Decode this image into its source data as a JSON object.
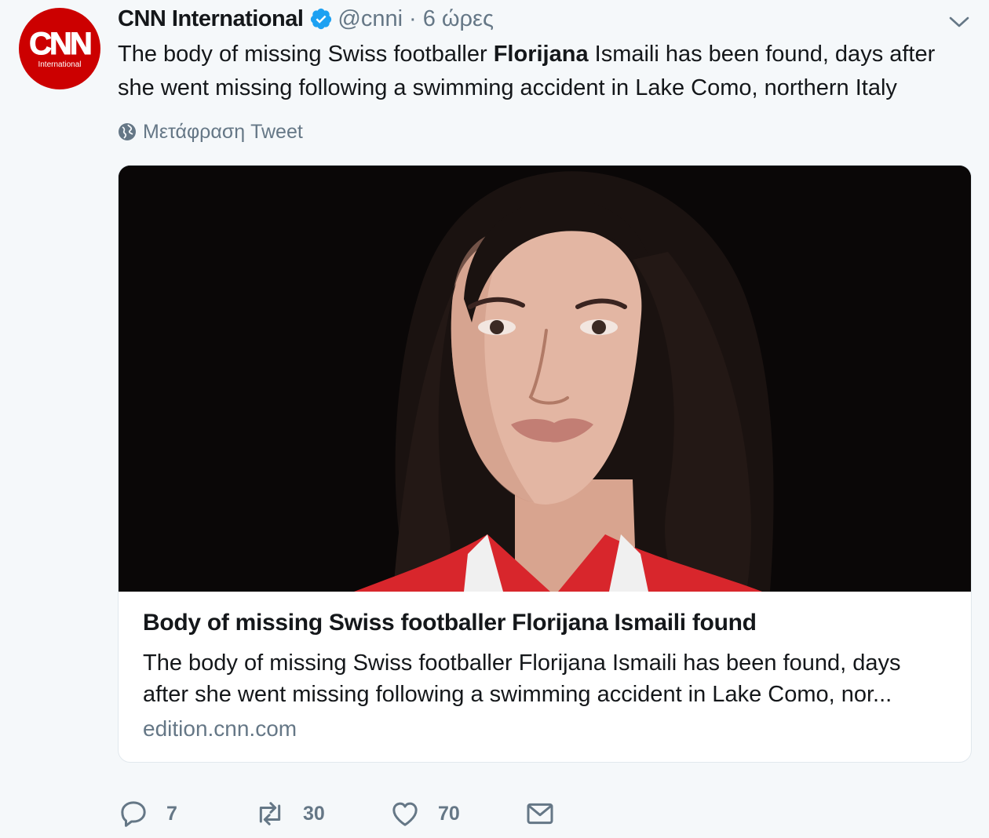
{
  "tweet": {
    "author": {
      "name": "CNN International",
      "handle": "@cnni",
      "separator": "·",
      "time": "6 ώρες",
      "avatar_logo": "CNN",
      "avatar_sub": "International",
      "verified_icon": "verified-badge-icon",
      "brand_color": "#cc0000"
    },
    "text_before": "The body of missing Swiss footballer ",
    "text_bold": "Florijana",
    "text_after": " Ismaili has been found, days after she went missing following a swimming accident in Lake Como, northern Italy",
    "translate_label": "Μετάφραση Tweet",
    "card": {
      "title": "Body of missing Swiss footballer Florijana Ismaili found",
      "description": "The body of missing Swiss footballer Florijana Ismaili has been found, days after she went missing following a swimming accident in Lake Como, nor...",
      "domain": "edition.cnn.com"
    },
    "actions": {
      "reply_count": "7",
      "retweet_count": "30",
      "like_count": "70"
    }
  },
  "colors": {
    "text": "#14171a",
    "secondary": "#657786",
    "verified": "#1da1f2",
    "background": "#f5f8fa"
  }
}
